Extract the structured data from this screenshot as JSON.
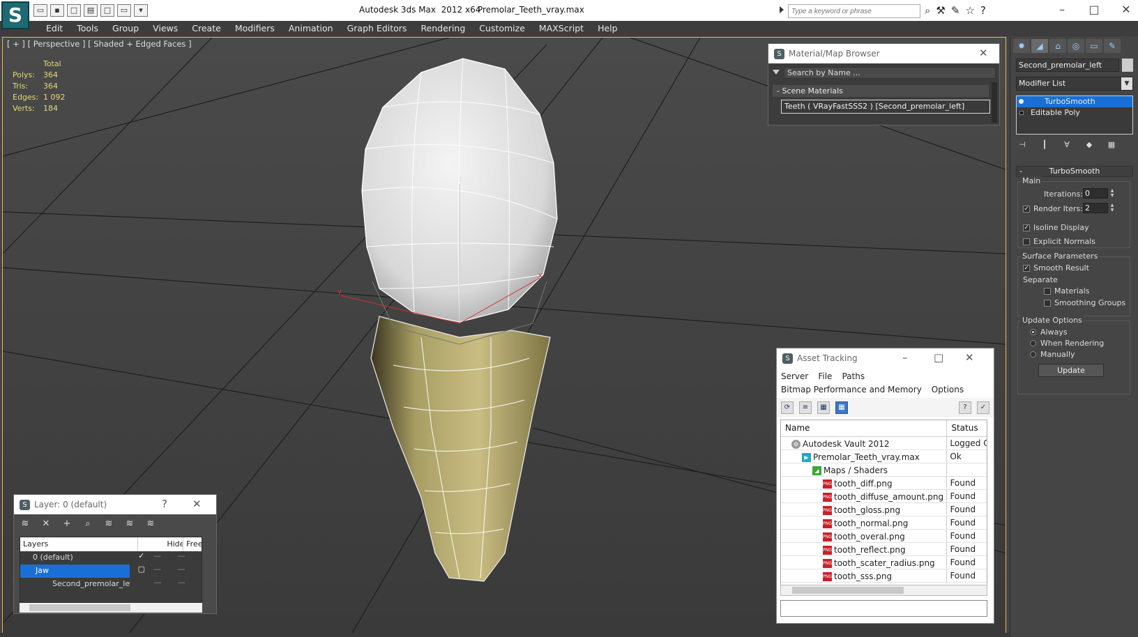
{
  "title": {
    "app": "Autodesk 3ds Max  2012 x64",
    "file": "Premolar_Teeth_vray.max"
  },
  "search": {
    "placeholder": "Type a keyword or phrase"
  },
  "menu": [
    "Edit",
    "Tools",
    "Group",
    "Views",
    "Create",
    "Modifiers",
    "Animation",
    "Graph Editors",
    "Rendering",
    "Customize",
    "MAXScript",
    "Help"
  ],
  "viewport": {
    "label": "[ + ] [ Perspective ] [ Shaded + Edged Faces ]",
    "stats_header": "Total",
    "stats": [
      {
        "label": "Polys:",
        "value": "364"
      },
      {
        "label": "Tris:",
        "value": "364"
      },
      {
        "label": "Edges:",
        "value": "1 092"
      },
      {
        "label": "Verts:",
        "value": "184"
      }
    ],
    "axis": {
      "z": "z",
      "y": "y",
      "x": "x"
    }
  },
  "material_browser": {
    "title": "Material/Map Browser",
    "search_placeholder": "Search by Name ...",
    "section": "- Scene Materials",
    "item": "Teeth  ( VRayFastSSS2 ) [Second_premolar_left]"
  },
  "asset_tracking": {
    "title": "Asset Tracking",
    "menu1": [
      "Server",
      "File",
      "Paths"
    ],
    "menu2": [
      "Bitmap Performance and Memory",
      "Options"
    ],
    "columns": {
      "name": "Name",
      "status": "Status"
    },
    "rows": [
      {
        "name": "Autodesk Vault 2012",
        "status": "Logged Out",
        "icon": "vault",
        "indent": 1
      },
      {
        "name": "Premolar_Teeth_vray.max",
        "status": "Ok",
        "icon": "max",
        "indent": 2
      },
      {
        "name": "Maps / Shaders",
        "status": "",
        "icon": "map",
        "indent": 3
      },
      {
        "name": "tooth_diff.png",
        "status": "Found",
        "icon": "png",
        "indent": 4
      },
      {
        "name": "tooth_diffuse_amount.png",
        "status": "Found",
        "icon": "png",
        "indent": 4
      },
      {
        "name": "tooth_gloss.png",
        "status": "Found",
        "icon": "png",
        "indent": 4
      },
      {
        "name": "tooth_normal.png",
        "status": "Found",
        "icon": "png",
        "indent": 4
      },
      {
        "name": "tooth_overal.png",
        "status": "Found",
        "icon": "png",
        "indent": 4
      },
      {
        "name": "tooth_reflect.png",
        "status": "Found",
        "icon": "png",
        "indent": 4
      },
      {
        "name": "tooth_scater_radius.png",
        "status": "Found",
        "icon": "png",
        "indent": 4
      },
      {
        "name": "tooth_sss.png",
        "status": "Found",
        "icon": "png",
        "indent": 4
      }
    ]
  },
  "layer_dialog": {
    "title": "Layer: 0 (default)",
    "help": "?",
    "columns": {
      "layers": "Layers",
      "hide": "Hide",
      "freeze": "Freeze"
    },
    "rows": [
      {
        "name": "0 (default)"
      },
      {
        "name": "Jaw"
      },
      {
        "name": "Second_premolar_left"
      }
    ]
  },
  "command_panel": {
    "object_name": "Second_premolar_left",
    "modifier_list": "Modifier List",
    "stack": [
      "TurboSmooth",
      "Editable Poly"
    ],
    "rollout_title": "TurboSmooth",
    "main_label": "Main",
    "iterations_label": "Iterations:",
    "iterations_value": "0",
    "render_iters_label": "Render Iters:",
    "render_iters_value": "2",
    "isoline_label": "Isoline Display",
    "explicit_normals_label": "Explicit Normals",
    "surface_params_label": "Surface Parameters",
    "smooth_result_label": "Smooth Result",
    "separate_label": "Separate",
    "materials_label": "Materials",
    "smoothing_groups_label": "Smoothing Groups",
    "update_options_label": "Update Options",
    "always_label": "Always",
    "when_rendering_label": "When Rendering",
    "manually_label": "Manually",
    "update_button": "Update"
  }
}
